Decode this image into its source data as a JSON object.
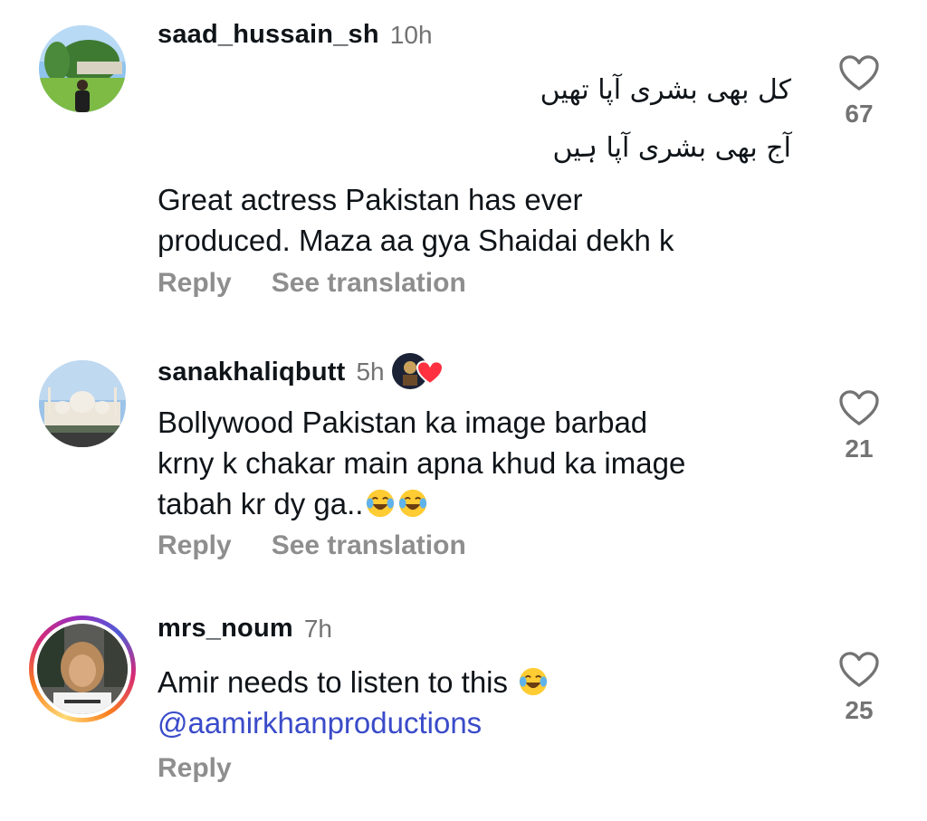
{
  "comments": [
    {
      "username": "saad_hussain_sh",
      "time": "10h",
      "urdu_lines": [
        "کل بھی بشری آپا تھیں",
        "آج بھی بشری آپا ہیں"
      ],
      "text_lines": [
        "Great actress Pakistan has ever",
        "produced. Maza aa gya Shaidai dekh k"
      ],
      "actions": [
        "Reply",
        "See translation"
      ],
      "likes": "67"
    },
    {
      "username": "sanakhaliqbutt",
      "time": "5h",
      "creator_liked": true,
      "text_lines": [
        "Bollywood Pakistan ka image barbad",
        "krny k chakar main apna khud ka image",
        "tabah kr dy ga.."
      ],
      "emoji": [
        "face-with-tears-of-joy",
        "face-with-tears-of-joy"
      ],
      "actions": [
        "Reply",
        "See translation"
      ],
      "likes": "21"
    },
    {
      "username": "mrs_noum",
      "time": "7h",
      "has_story_ring": true,
      "text_lines": [
        "Amir needs to listen to this "
      ],
      "emoji": [
        "face-with-tears-of-joy"
      ],
      "mention": "@aamirkhanproductions",
      "actions": [
        "Reply"
      ],
      "likes": "25"
    }
  ],
  "icons": {
    "like": "heart-outline-icon",
    "creator_like": "heart-filled-icon"
  },
  "colors": {
    "mention": "#3a4bc9",
    "secondary_text": "#737373",
    "heart_red": "#ff3040"
  }
}
